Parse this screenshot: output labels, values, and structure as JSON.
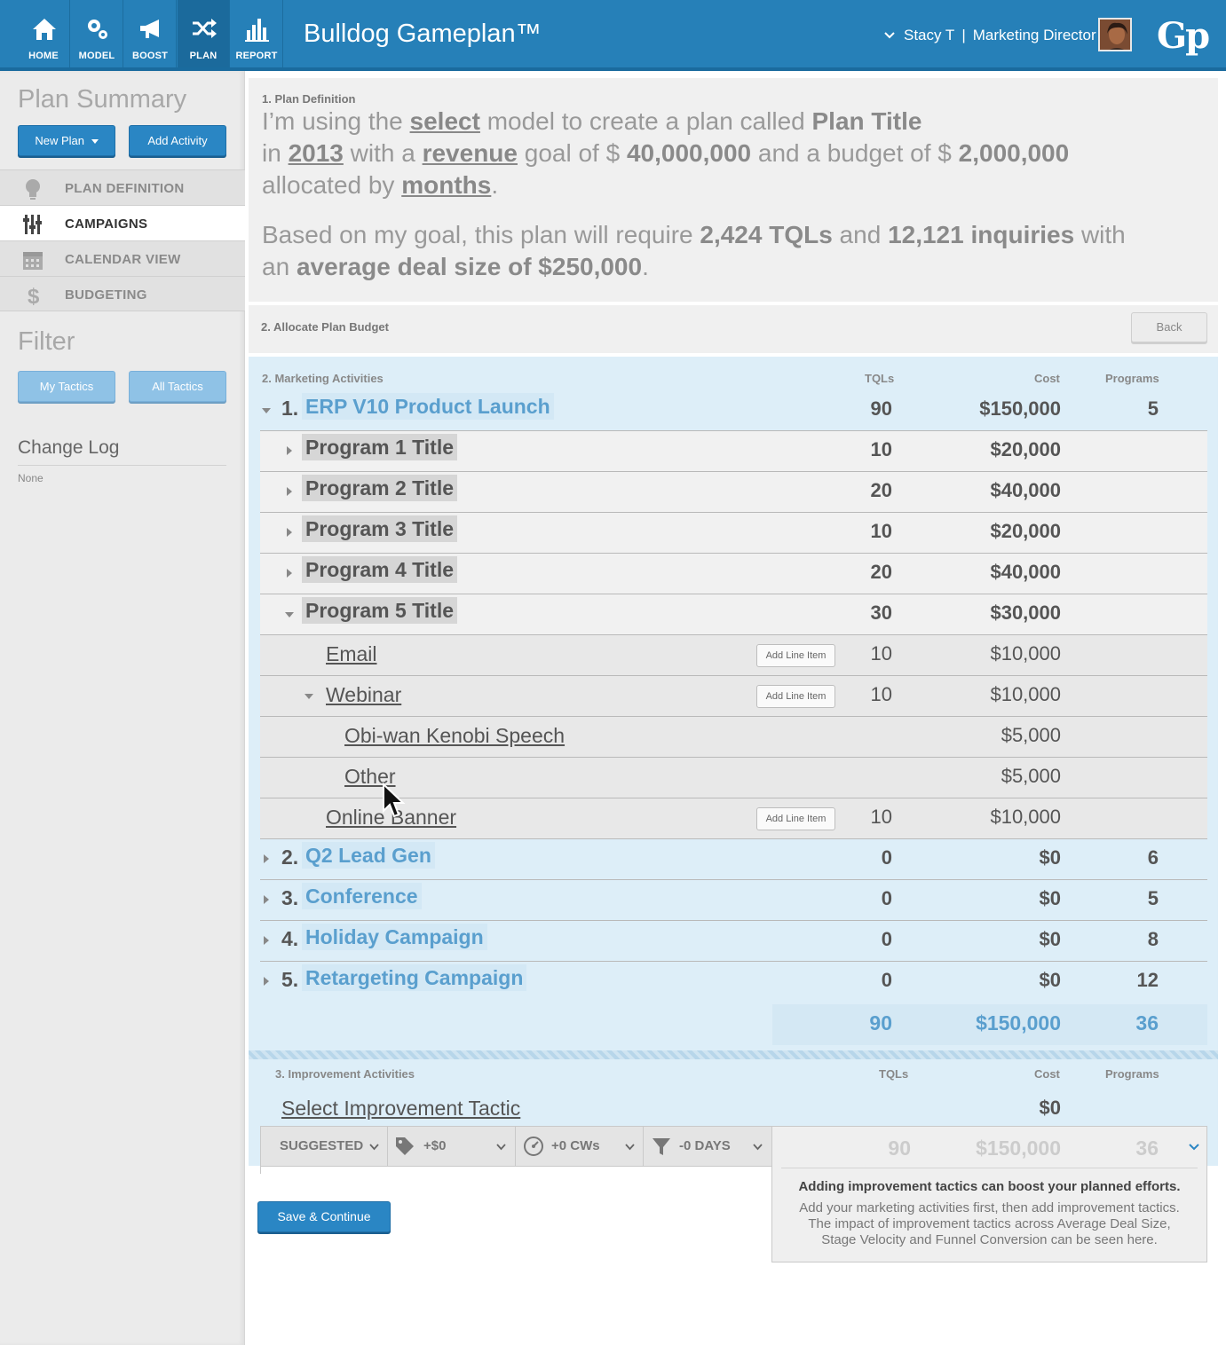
{
  "colors": {
    "topbar": "#2680b8",
    "topbar_active": "#1b6a9c",
    "accent_blue": "#5a9fce",
    "button_blue": "#2a86c4",
    "button_light": "#8fc2e6",
    "activities_bg": "#ddeef8"
  },
  "nav": [
    {
      "label": "HOME",
      "icon": "home-icon"
    },
    {
      "label": "MODEL",
      "icon": "gears-icon"
    },
    {
      "label": "BOOST",
      "icon": "megaphone-icon"
    },
    {
      "label": "PLAN",
      "icon": "shuffle-icon",
      "active": true
    },
    {
      "label": "REPORT",
      "icon": "bar-chart-icon"
    }
  ],
  "app": {
    "title": "Bulldog Gameplan™",
    "logo": "Gp"
  },
  "user": {
    "name": "Stacy T",
    "separator": "|",
    "role": "Marketing Director"
  },
  "sidebar": {
    "plan_summary": "Plan Summary",
    "new_plan": "New Plan",
    "add_activity": "Add Activity",
    "items": [
      {
        "label": "PLAN DEFINITION",
        "icon": "lightbulb-icon"
      },
      {
        "label": "CAMPAIGNS",
        "icon": "sliders-icon",
        "active": true
      },
      {
        "label": "CALENDAR VIEW",
        "icon": "calendar-icon"
      },
      {
        "label": "BUDGETING",
        "icon": "dollar-icon"
      }
    ],
    "filter": "Filter",
    "my_tactics": "My Tactics",
    "all_tactics": "All Tactics",
    "change_log": "Change Log",
    "change_log_value": "None"
  },
  "definition": {
    "section_label": "1. Plan Definition",
    "t1": "I’m using the ",
    "model": "select",
    "t2": " model to create a plan called ",
    "plan_title": "Plan Title",
    "t3": "in ",
    "year": "2013",
    "t4": " with a ",
    "goal_type": "revenue",
    "t5": " goal of $ ",
    "goal": "40,000,000",
    "t6": " and a budget of $ ",
    "budget": "2,000,000",
    "t7": "allocated by ",
    "allocation": "months",
    "t8": ".",
    "s1": "Based on my goal, this plan will require ",
    "tqls": "2,424 TQLs",
    "s2": " and ",
    "inquiries": "12,121 inquiries",
    "s3": " with",
    "s4": "an ",
    "deal": "average deal size of $250,000",
    "s5": "."
  },
  "allocate": {
    "label": "2. Allocate Plan Budget",
    "back": "Back"
  },
  "activities": {
    "label": "2. Marketing Activities",
    "col_tqls": "TQLs",
    "col_cost": "Cost",
    "col_programs": "Programs",
    "add_line_item": "Add Line Item",
    "campaign1": {
      "num": "1.",
      "title": "ERP V10 Product Launch",
      "tqls": "90",
      "cost": "$150,000",
      "programs": "5"
    },
    "programs": [
      {
        "title": "Program 1 Title",
        "tqls": "10",
        "cost": "$20,000"
      },
      {
        "title": "Program 2 Title",
        "tqls": "20",
        "cost": "$40,000"
      },
      {
        "title": "Program 3 Title",
        "tqls": "10",
        "cost": "$20,000"
      },
      {
        "title": "Program 4 Title",
        "tqls": "20",
        "cost": "$40,000"
      },
      {
        "title": "Program 5 Title",
        "tqls": "30",
        "cost": "$30,000"
      }
    ],
    "tactics": [
      {
        "title": "Email",
        "tqls": "10",
        "cost": "$10,000"
      },
      {
        "title": "Webinar",
        "tqls": "10",
        "cost": "$10,000"
      }
    ],
    "line_items": [
      {
        "title": "Obi-wan Kenobi Speech",
        "cost": "$5,000"
      },
      {
        "title": "Other",
        "cost": "$5,000"
      }
    ],
    "tactic3": {
      "title": "Online Banner",
      "tqls": "10",
      "cost": "$10,000"
    },
    "campaigns": [
      {
        "num": "2.",
        "title": "Q2 Lead Gen",
        "tqls": "0",
        "cost": "$0",
        "programs": "6"
      },
      {
        "num": "3.",
        "title": "Conference",
        "tqls": "0",
        "cost": "$0",
        "programs": "5"
      },
      {
        "num": "4.",
        "title": "Holiday Campaign",
        "tqls": "0",
        "cost": "$0",
        "programs": "8"
      },
      {
        "num": "5.",
        "title": "Retargeting Campaign",
        "tqls": "0",
        "cost": "$0",
        "programs": "12"
      }
    ],
    "totals": {
      "tqls": "90",
      "cost": "$150,000",
      "programs": "36"
    }
  },
  "improvement": {
    "label": "3. Improvement Activities",
    "col_tqls": "TQLs",
    "col_cost": "Cost",
    "col_programs": "Programs",
    "select_tactic": "Select Improvement Tactic",
    "cost": "$0",
    "filters": {
      "suggested": "SUGGESTED",
      "price": "+$0",
      "cws": "+0 CWs",
      "days": "-0 DAYS"
    },
    "summary": {
      "tqls": "90",
      "cost": "$150,000",
      "programs": "36"
    },
    "box_heading": "Adding improvement tactics can boost your planned efforts.",
    "box_text": "Add your marketing activities first, then add improvement tactics. The impact of improvement tactics across Average Deal Size, Stage Velocity and Funnel Conversion can be seen here."
  },
  "save_continue": "Save & Continue"
}
